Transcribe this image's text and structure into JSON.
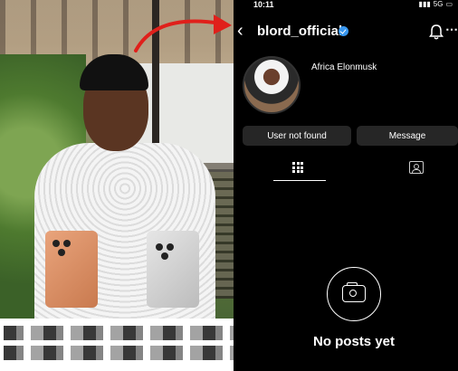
{
  "status_bar": {
    "time": "10:11",
    "network": "5G"
  },
  "profile": {
    "username": "blord_official",
    "display_name": "Africa Elonmusk",
    "verified": true
  },
  "buttons": {
    "primary": "User not found",
    "secondary": "Message"
  },
  "tabs": {
    "active": "grid-icon",
    "other": "tagged-icon"
  },
  "empty_state": {
    "text": "No posts yet"
  },
  "colors": {
    "verified": "#3897f0",
    "arrow": "#e0201b",
    "button_bg": "#262626"
  }
}
